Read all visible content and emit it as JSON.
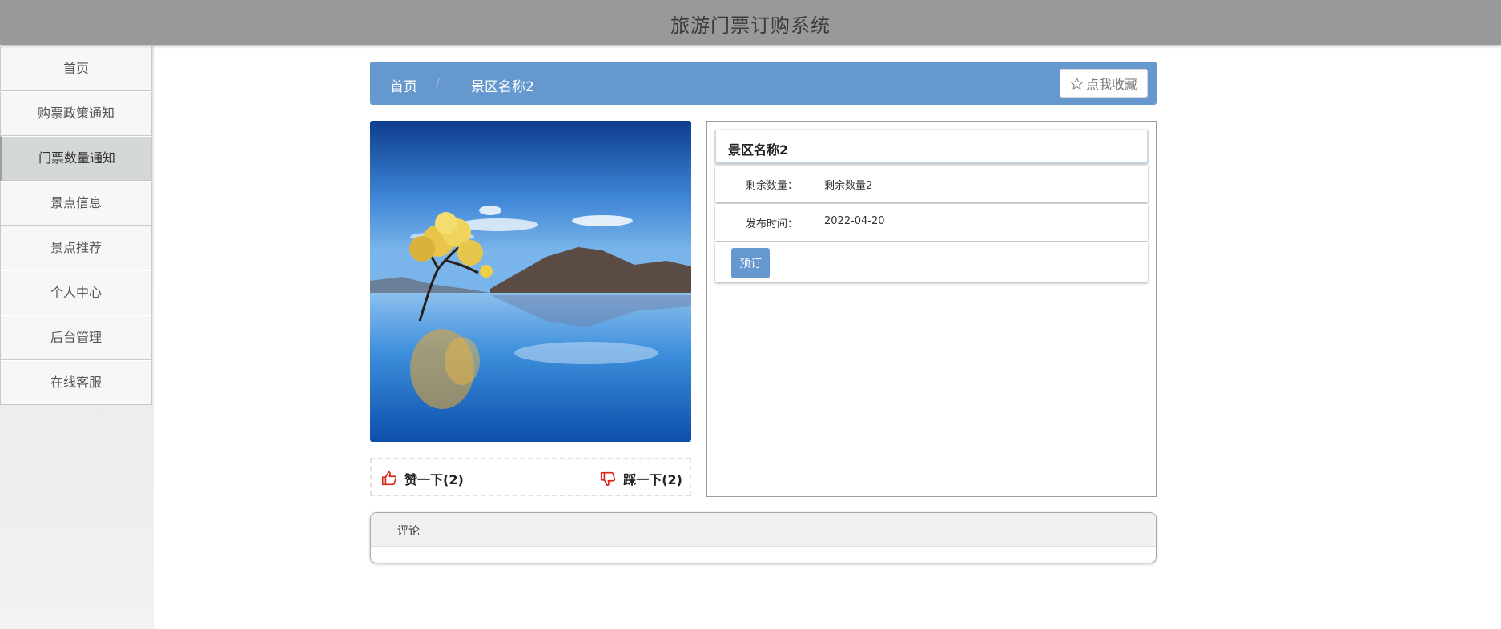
{
  "header": {
    "title": "旅游门票订购系统"
  },
  "sidebar": {
    "items": [
      {
        "label": "首页"
      },
      {
        "label": "购票政策通知"
      },
      {
        "label": "门票数量通知"
      },
      {
        "label": "景点信息"
      },
      {
        "label": "景点推荐"
      },
      {
        "label": "个人中心"
      },
      {
        "label": "后台管理"
      },
      {
        "label": "在线客服"
      }
    ],
    "active_index": 2
  },
  "breadcrumb": {
    "home": "首页",
    "separator": "/",
    "current": "景区名称2"
  },
  "favorite_button": {
    "label": "点我收藏",
    "icon": "star-icon"
  },
  "votes": {
    "like_label": "赞一下(2)",
    "dislike_label": "踩一下(2)",
    "like_icon": "thumbs-up-icon",
    "dislike_icon": "thumbs-down-icon",
    "icon_color": "#d9261c"
  },
  "detail": {
    "name": "景区名称2",
    "fields": [
      {
        "label": "剩余数量：",
        "value": "剩余数量2"
      },
      {
        "label": "发布时间：",
        "value": "2022-04-20"
      }
    ],
    "book_button": "预订"
  },
  "comments": {
    "title": "评论"
  },
  "colors": {
    "accent": "#6598cf",
    "header_bg": "#979a99"
  }
}
